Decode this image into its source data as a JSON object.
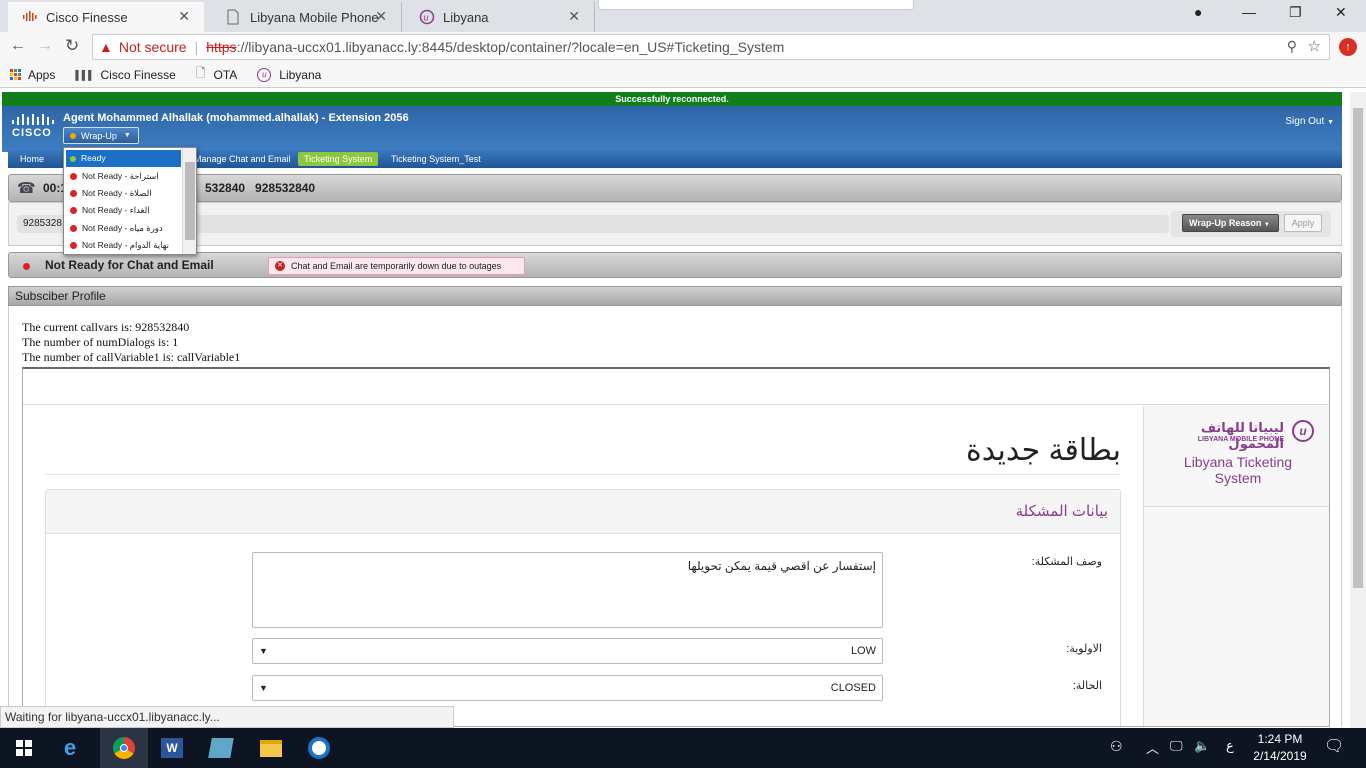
{
  "browser": {
    "tabs": [
      {
        "title": "Cisco Finesse",
        "active": true
      },
      {
        "title": "Libyana Mobile Phone",
        "active": false
      },
      {
        "title": "Libyana",
        "active": false
      }
    ],
    "security_label": "Not secure",
    "url_scheme": "https",
    "url_rest": "://libyana-uccx01.libyanacc.ly:8445/desktop/container/?locale=en_US#Ticketing_System",
    "bookmarks": [
      "Apps",
      "Cisco Finesse",
      "OTA",
      "Libyana"
    ],
    "status_text": "Waiting for libyana-uccx01.libyanacc.ly..."
  },
  "finesse": {
    "banner": "Successfully reconnected.",
    "logo_text": "CISCO",
    "agent_line": "Agent Mohammed Alhallak (mohammed.alhallak) - Extension 2056",
    "state_button": "Wrap-Up",
    "sign_out": "Sign Out",
    "nav_tabs": [
      "Home",
      "Manage Chat and Email",
      "Ticketing System",
      "Ticketing System_Test"
    ],
    "call_timer": "00:1",
    "call_numbers": "532840   928532840",
    "call_field_value": "9285328",
    "wrapup_reason_button": "Wrap-Up Reason",
    "apply_button": "Apply",
    "chat_status": "Not Ready for Chat and Email",
    "chat_alert": "Chat and Email are temporarily down due to outages",
    "subscriber_header": "Subsciber Profile",
    "profile_lines": [
      "The current callvars is: 928532840",
      "The number of numDialogs is: 1",
      "The number of callVariable1 is: callVariable1"
    ],
    "state_menu": [
      {
        "label": "Ready",
        "status": "ready"
      },
      {
        "label": "Not Ready - استراحة",
        "status": "notready"
      },
      {
        "label": "Not Ready - الصلاة",
        "status": "notready"
      },
      {
        "label": "Not Ready - الغداء",
        "status": "notready"
      },
      {
        "label": "Not Ready - دورة مياه",
        "status": "notready"
      },
      {
        "label": "Not Ready - نهاية الدوام",
        "status": "notready"
      }
    ]
  },
  "ticket": {
    "brand_arabic": "ليبيانا للهاتف المحمول",
    "brand_english": "LIBYANA MOBILE PHONE",
    "brand_subtitle": "Libyana Ticketing System",
    "page_title": "بطاقة جديدة",
    "section_title": "بيانات المشكلة",
    "description_label": "وصف المشكلة:",
    "description_value": "إستفسار عن اقصي قيمة يمكن تحويلها",
    "priority_label": "الاولوية:",
    "priority_value": "LOW",
    "status_label": "الحالة:",
    "status_value": "CLOSED"
  },
  "taskbar": {
    "time": "1:24 PM",
    "date": "2/14/2019",
    "lang": "ع"
  },
  "colors": {
    "finesse_blue": "#2e67a8",
    "banner_green": "#0f7e1b",
    "ticket_purple": "#8a3d8c",
    "active_nav": "#8dc63f"
  }
}
